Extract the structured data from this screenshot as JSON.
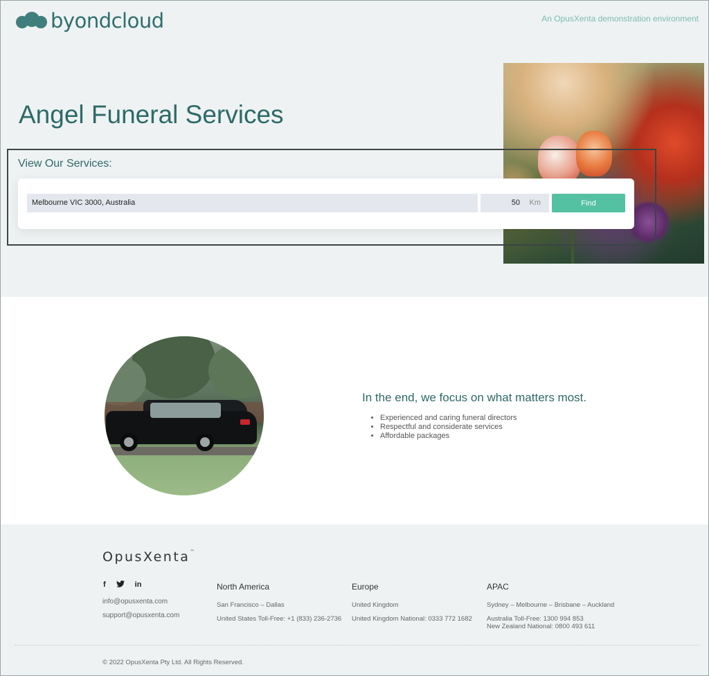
{
  "header": {
    "logo_text": "byondcloud",
    "tagline": "An OpusXenta demonstration environment"
  },
  "hero": {
    "title": "Angel Funeral Services",
    "services_label": "View Our Services:",
    "search": {
      "location_value": "Melbourne VIC 3000, Australia",
      "radius_value": "50",
      "radius_unit": "Km",
      "find_label": "Find"
    }
  },
  "info": {
    "heading": "In the end, we focus on what matters most.",
    "bullets": [
      "Experienced and caring funeral directors",
      "Respectful and considerate services",
      "Affordable packages"
    ]
  },
  "footer": {
    "logo_text": "OpusXenta",
    "logo_tm": "™",
    "social_icons": [
      "facebook-icon",
      "twitter-icon",
      "linkedin-icon"
    ],
    "social_glyphs": [
      "f",
      "🐦",
      "in"
    ],
    "emails": [
      "info@opusxenta.com",
      "support@opusxenta.com"
    ],
    "columns": [
      {
        "title": "North America",
        "lines": [
          "San Francisco – Dallas",
          "",
          "United States Toll-Free: +1 (833) 236-2736"
        ]
      },
      {
        "title": "Europe",
        "lines": [
          "United Kingdom",
          "",
          "United Kingdom National: 0333 772 1682"
        ]
      },
      {
        "title": "APAC",
        "lines": [
          "Sydney – Melbourne – Brisbane – Auckland",
          "",
          "Australia Toll-Free: 1300 994 853",
          "New Zealand National: 0800 493 611"
        ]
      }
    ],
    "copyright": "© 2022 OpusXenta Pty Ltd. All Rights Reserved."
  },
  "colors": {
    "brand_teal": "#2e6a67",
    "accent_green": "#55c1a3",
    "background_light": "#eef2f3"
  }
}
